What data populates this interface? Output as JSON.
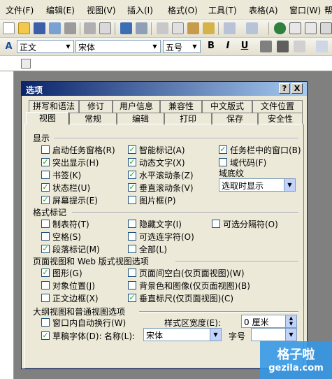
{
  "menu": [
    "文件(F)",
    "编辑(E)",
    "视图(V)",
    "插入(I)",
    "格式(O)",
    "工具(T)",
    "表格(A)",
    "窗口(W)",
    "帮"
  ],
  "format_toolbar": {
    "style": "正文",
    "font": "宋体",
    "size": "五号",
    "bold": "B",
    "italic": "I",
    "underline": "U",
    "font_style_icon": "A"
  },
  "dialog": {
    "title": "选项",
    "help_button": "?",
    "close_button": "X",
    "tabs_row1": [
      "拼写和语法",
      "修订",
      "用户信息",
      "兼容性",
      "中文版式",
      "文件位置"
    ],
    "tabs_row2": [
      "视图",
      "常规",
      "编辑",
      "打印",
      "保存",
      "安全性"
    ],
    "active_tab": "视图",
    "sections": {
      "display": {
        "title": "显示",
        "col1": [
          {
            "label": "启动任务窗格(R)",
            "checked": false
          },
          {
            "label": "突出显示(H)",
            "checked": true
          },
          {
            "label": "书签(K)",
            "checked": false
          },
          {
            "label": "状态栏(U)",
            "checked": true
          },
          {
            "label": "屏幕提示(E)",
            "checked": true
          }
        ],
        "col2": [
          {
            "label": "智能标记(A)",
            "checked": true
          },
          {
            "label": "动态文字(X)",
            "checked": true
          },
          {
            "label": "水平滚动条(Z)",
            "checked": true
          },
          {
            "label": "垂直滚动条(V)",
            "checked": true
          },
          {
            "label": "图片框(P)",
            "checked": false
          }
        ],
        "col3": [
          {
            "label": "任务栏中的窗口(B)",
            "checked": true
          },
          {
            "label": "域代码(F)",
            "checked": false
          }
        ],
        "field_shading_label": "域底纹",
        "field_shading_value": "选取时显示"
      },
      "format_marks": {
        "title": "格式标记",
        "col1": [
          {
            "label": "制表符(T)",
            "checked": false
          },
          {
            "label": "空格(S)",
            "checked": false
          },
          {
            "label": "段落标记(M)",
            "checked": true
          }
        ],
        "col2": [
          {
            "label": "隐藏文字(I)",
            "checked": false
          },
          {
            "label": "可选连字符(O)",
            "checked": false
          },
          {
            "label": "全部(L)",
            "checked": false
          }
        ],
        "col3": [
          {
            "label": "可选分隔符(O)",
            "checked": false
          }
        ]
      },
      "page_view": {
        "title": "页面视图和 Web 版式视图选项",
        "col1": [
          {
            "label": "图形(G)",
            "checked": true
          },
          {
            "label": "对象位置(J)",
            "checked": false
          },
          {
            "label": "正文边框(X)",
            "checked": false
          }
        ],
        "col2": [
          {
            "label": "页面间空白(仅页面视图)(W)",
            "checked": false
          },
          {
            "label": "背景色和图像(仅页面视图)(B)",
            "checked": false
          },
          {
            "label": "垂直标尺(仅页面视图)(C)",
            "checked": true
          }
        ]
      },
      "outline_view": {
        "title": "大纲视图和普通视图选项",
        "wrap": {
          "label": "窗口内自动换行(W)",
          "checked": false
        },
        "draft_font": {
          "label": "草稿字体(D):",
          "checked": true
        },
        "name_label": "名称(L):",
        "name_value": "宋体",
        "size_label": "字号",
        "style_area_label": "样式区宽度(E):",
        "style_area_value": "0 厘米"
      }
    }
  },
  "watermark": {
    "line1": "格子啦",
    "line2": "gezila.com"
  }
}
